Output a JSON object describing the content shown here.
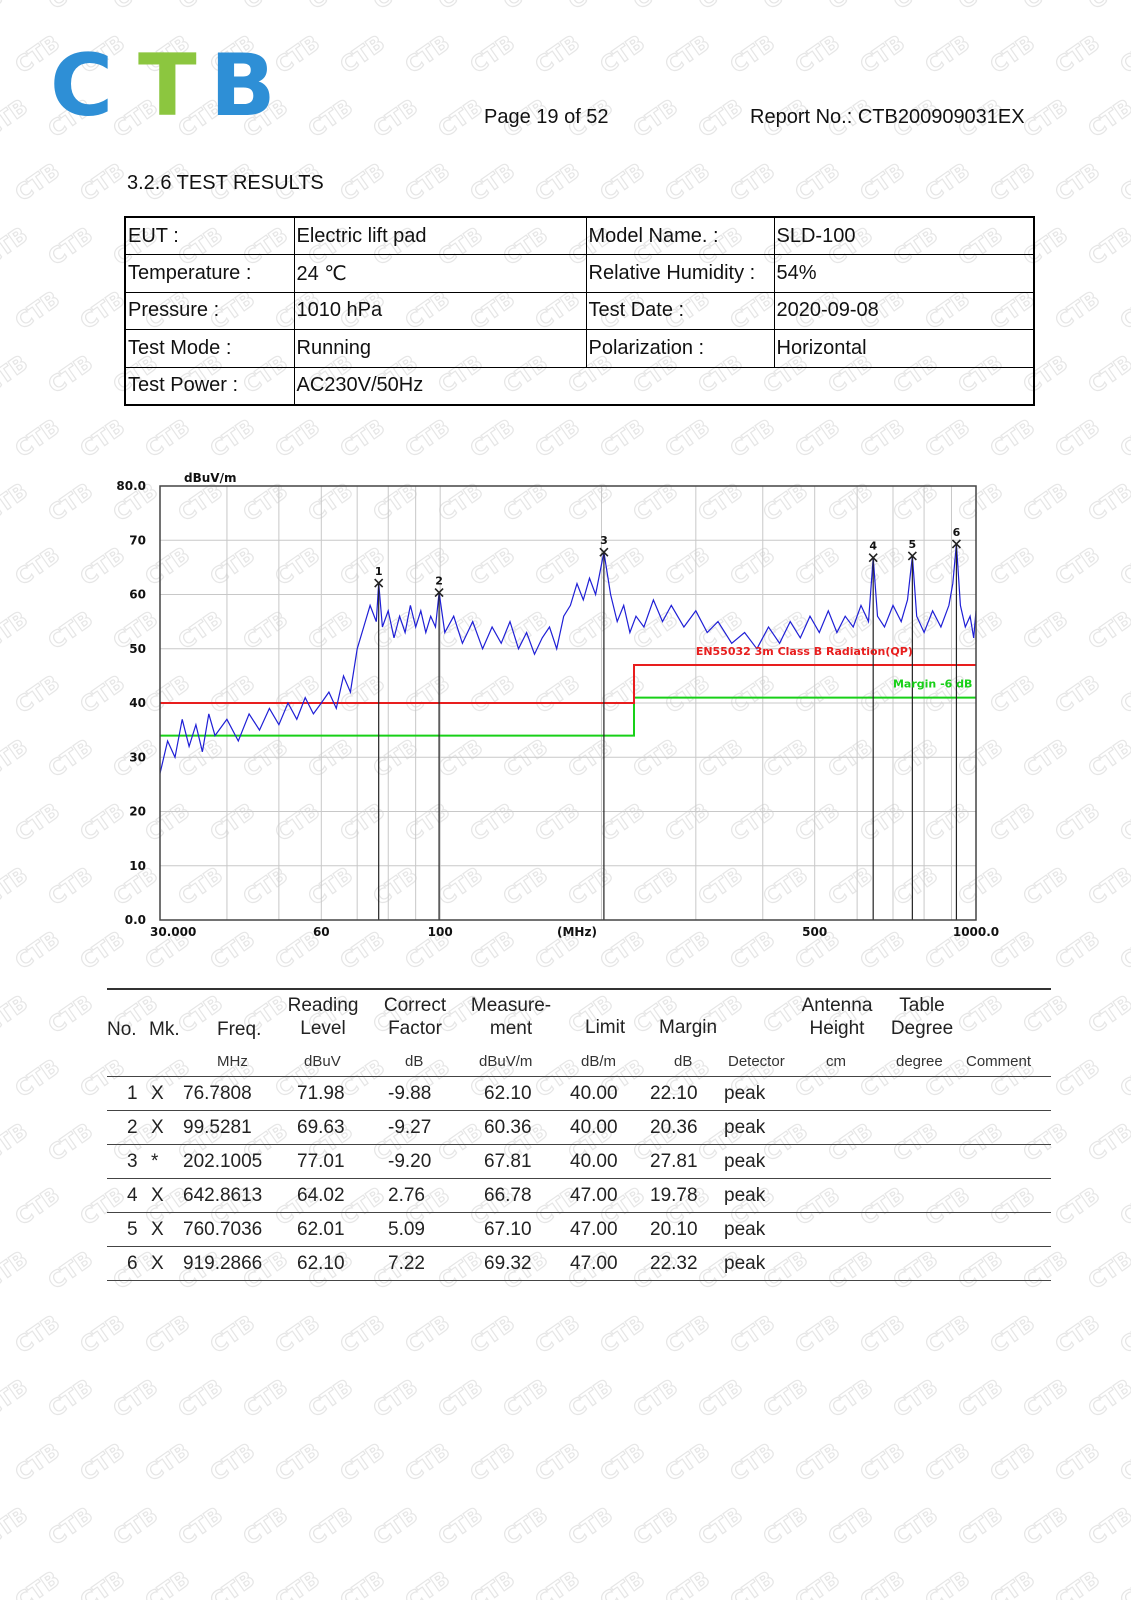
{
  "logo": {
    "text": "CTB",
    "colors": [
      "#2e8fd6",
      "#8cc63f",
      "#2e8fd6"
    ]
  },
  "watermark": {
    "text": "CTB",
    "color": "#e6e6e6"
  },
  "header": {
    "page": "Page 19 of 52",
    "report": "Report No.:  CTB200909031EX"
  },
  "section_title": "3.2.6  TEST RESULTS",
  "info": {
    "eut_label": "EUT :",
    "eut_value": "Electric lift pad",
    "model_label": "Model Name.  :",
    "model_value": "SLD-100",
    "temp_label": "Temperature :",
    "temp_value": "24 ℃",
    "humidity_label": "Relative Humidity :",
    "humidity_value": "54%",
    "pressure_label": "Pressure :",
    "pressure_value": "1010 hPa",
    "date_label": "Test Date :",
    "date_value": "2020-09-08",
    "mode_label": "Test Mode   :",
    "mode_value": "Running",
    "polar_label": "Polarization :",
    "polar_value": "Horizontal",
    "power_label": "Test Power   :",
    "power_value": "AC230V/50Hz"
  },
  "chart_data": {
    "type": "line",
    "x_scale": "log",
    "xlim": [
      30,
      1000
    ],
    "ylim": [
      0,
      80
    ],
    "ylabel": "dBuV/m",
    "xlabel": "(MHz)",
    "y_ticks": [
      "0.0",
      "10",
      "20",
      "30",
      "40",
      "50",
      "60",
      "70",
      "80.0"
    ],
    "x_ticks": [
      {
        "v": 30,
        "label": "30.000"
      },
      {
        "v": 60,
        "label": "60"
      },
      {
        "v": 100,
        "label": "100"
      },
      {
        "v": 180,
        "label": "(MHz)"
      },
      {
        "v": 500,
        "label": "500"
      },
      {
        "v": 1000,
        "label": "1000.0"
      }
    ],
    "grid": true,
    "colors": {
      "trace": "#1f1fd6",
      "limit": "#e81e1e",
      "margin": "#18d018",
      "marker": "#222222"
    },
    "limit_line": {
      "name": "EN55032 3m Class B Radiation(QP)",
      "segments": [
        [
          30,
          40
        ],
        [
          230,
          40
        ],
        [
          230,
          47
        ],
        [
          1000,
          47
        ]
      ]
    },
    "margin_line": {
      "name": "Margin -6 dB",
      "segments": [
        [
          30,
          34
        ],
        [
          230,
          34
        ],
        [
          230,
          41
        ],
        [
          1000,
          41
        ]
      ]
    },
    "series": [
      {
        "values": [
          [
            30,
            27
          ],
          [
            31,
            33
          ],
          [
            32,
            30
          ],
          [
            33,
            37
          ],
          [
            34,
            32
          ],
          [
            35,
            36
          ],
          [
            36,
            31
          ],
          [
            37,
            38
          ],
          [
            38,
            34
          ],
          [
            40,
            37
          ],
          [
            42,
            33
          ],
          [
            44,
            38
          ],
          [
            46,
            35
          ],
          [
            48,
            39
          ],
          [
            50,
            36
          ],
          [
            52,
            40
          ],
          [
            54,
            37
          ],
          [
            56,
            41
          ],
          [
            58,
            38
          ],
          [
            60,
            40
          ],
          [
            62,
            42
          ],
          [
            64,
            39
          ],
          [
            66,
            45
          ],
          [
            68,
            42
          ],
          [
            70,
            50
          ],
          [
            72,
            54
          ],
          [
            74,
            58
          ],
          [
            76,
            55
          ],
          [
            76.78,
            62.1
          ],
          [
            78,
            54
          ],
          [
            80,
            57
          ],
          [
            82,
            52
          ],
          [
            84,
            56
          ],
          [
            86,
            53
          ],
          [
            88,
            58
          ],
          [
            90,
            54
          ],
          [
            92,
            57
          ],
          [
            94,
            53
          ],
          [
            96,
            56
          ],
          [
            98,
            54
          ],
          [
            99.53,
            60.36
          ],
          [
            102,
            53
          ],
          [
            106,
            56
          ],
          [
            110,
            51
          ],
          [
            115,
            55
          ],
          [
            120,
            50
          ],
          [
            125,
            54
          ],
          [
            130,
            51
          ],
          [
            135,
            55
          ],
          [
            140,
            50
          ],
          [
            145,
            53
          ],
          [
            150,
            49
          ],
          [
            155,
            52
          ],
          [
            160,
            54
          ],
          [
            165,
            50
          ],
          [
            170,
            56
          ],
          [
            175,
            58
          ],
          [
            180,
            62
          ],
          [
            185,
            59
          ],
          [
            190,
            63
          ],
          [
            195,
            60
          ],
          [
            202.1,
            67.81
          ],
          [
            208,
            60
          ],
          [
            214,
            55
          ],
          [
            220,
            58
          ],
          [
            226,
            53
          ],
          [
            232,
            56
          ],
          [
            240,
            54
          ],
          [
            250,
            59
          ],
          [
            260,
            55
          ],
          [
            270,
            58
          ],
          [
            285,
            54
          ],
          [
            300,
            57
          ],
          [
            315,
            53
          ],
          [
            330,
            55
          ],
          [
            350,
            51
          ],
          [
            370,
            53
          ],
          [
            390,
            50
          ],
          [
            410,
            54
          ],
          [
            430,
            51
          ],
          [
            450,
            55
          ],
          [
            470,
            52
          ],
          [
            490,
            56
          ],
          [
            510,
            53
          ],
          [
            530,
            57
          ],
          [
            550,
            53
          ],
          [
            570,
            56
          ],
          [
            590,
            54
          ],
          [
            610,
            58
          ],
          [
            630,
            55
          ],
          [
            642.86,
            66.78
          ],
          [
            655,
            56
          ],
          [
            675,
            54
          ],
          [
            700,
            58
          ],
          [
            725,
            55
          ],
          [
            745,
            59
          ],
          [
            760.7,
            67.1
          ],
          [
            775,
            56
          ],
          [
            800,
            53
          ],
          [
            830,
            57
          ],
          [
            860,
            54
          ],
          [
            890,
            58
          ],
          [
            905,
            62
          ],
          [
            919.29,
            69.32
          ],
          [
            935,
            58
          ],
          [
            955,
            54
          ],
          [
            975,
            56
          ],
          [
            990,
            52
          ],
          [
            1000,
            57
          ]
        ]
      }
    ],
    "markers": [
      {
        "n": "1",
        "x": 76.7808,
        "y": 62.1
      },
      {
        "n": "2",
        "x": 99.5281,
        "y": 60.36
      },
      {
        "n": "3",
        "x": 202.1005,
        "y": 67.81
      },
      {
        "n": "4",
        "x": 642.8613,
        "y": 66.78
      },
      {
        "n": "5",
        "x": 760.7036,
        "y": 67.1
      },
      {
        "n": "6",
        "x": 919.2866,
        "y": 69.32
      }
    ]
  },
  "results": {
    "headers": {
      "no": "No.",
      "mk": "Mk.",
      "freq": "Freq.",
      "reading_1": "Reading",
      "reading_2": "Level",
      "correct_1": "Correct",
      "correct_2": "Factor",
      "measure_1": "Measure-",
      "measure_2": "ment",
      "limit": "Limit",
      "margin": "Margin",
      "antenna_1": "Antenna",
      "antenna_2": "Height",
      "table_1": "Table",
      "table_2": "Degree"
    },
    "units": {
      "freq": "MHz",
      "reading": "dBuV",
      "correct": "dB",
      "measure": "dBuV/m",
      "limit": "dB/m",
      "margin": "dB",
      "detector": "Detector",
      "antenna": "cm",
      "table": "degree",
      "comment": "Comment"
    },
    "rows": [
      {
        "no": "1",
        "mk": "X",
        "freq": "76.7808",
        "reading": "71.98",
        "correct": "-9.88",
        "measure": "62.10",
        "limit": "40.00",
        "margin": "22.10",
        "detector": "peak"
      },
      {
        "no": "2",
        "mk": "X",
        "freq": "99.5281",
        "reading": "69.63",
        "correct": "-9.27",
        "measure": "60.36",
        "limit": "40.00",
        "margin": "20.36",
        "detector": "peak"
      },
      {
        "no": "3",
        "mk": "*",
        "freq": "202.1005",
        "reading": "77.01",
        "correct": "-9.20",
        "measure": "67.81",
        "limit": "40.00",
        "margin": "27.81",
        "detector": "peak"
      },
      {
        "no": "4",
        "mk": "X",
        "freq": "642.8613",
        "reading": "64.02",
        "correct": "2.76",
        "measure": "66.78",
        "limit": "47.00",
        "margin": "19.78",
        "detector": "peak"
      },
      {
        "no": "5",
        "mk": "X",
        "freq": "760.7036",
        "reading": "62.01",
        "correct": "5.09",
        "measure": "67.10",
        "limit": "47.00",
        "margin": "20.10",
        "detector": "peak"
      },
      {
        "no": "6",
        "mk": "X",
        "freq": "919.2866",
        "reading": "62.10",
        "correct": "7.22",
        "measure": "69.32",
        "limit": "47.00",
        "margin": "22.32",
        "detector": "peak"
      }
    ]
  }
}
